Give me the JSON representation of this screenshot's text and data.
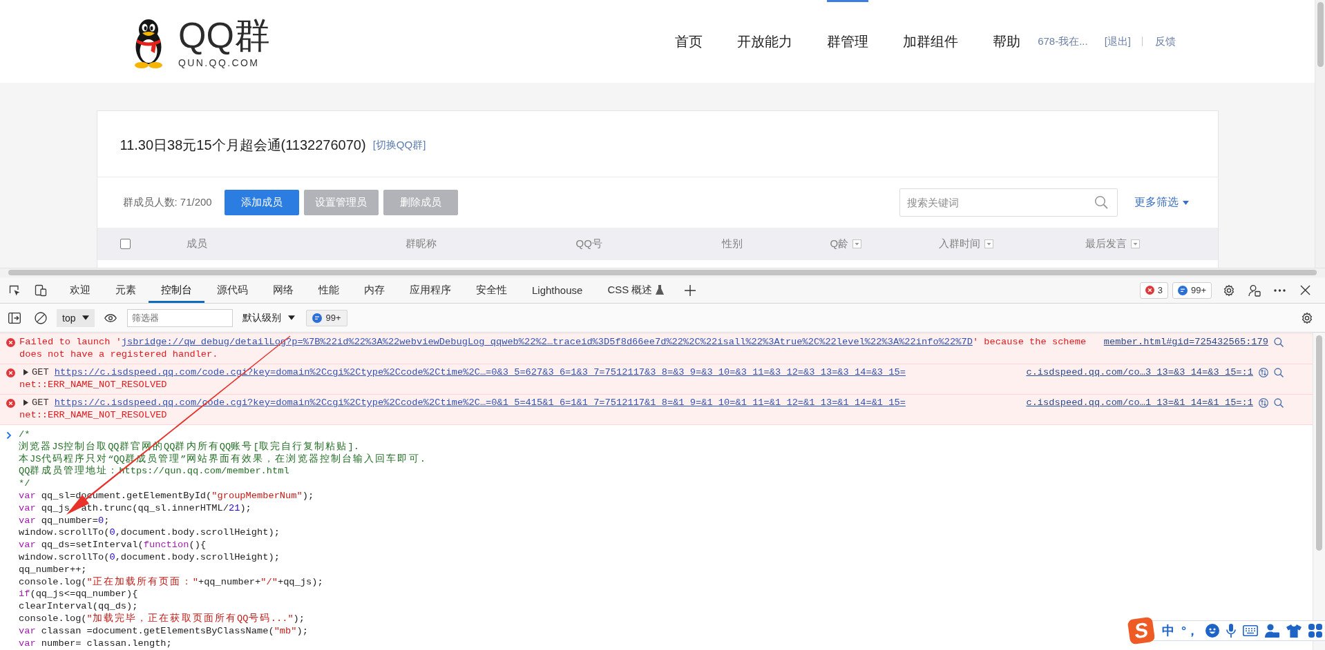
{
  "header": {
    "logo_text": "QQ群",
    "logo_subtitle": "QUN.QQ.COM",
    "nav": [
      {
        "label": "首页",
        "selected": false
      },
      {
        "label": "开放能力",
        "selected": false
      },
      {
        "label": "群管理",
        "selected": true
      },
      {
        "label": "加群组件",
        "selected": false
      },
      {
        "label": "帮助",
        "selected": false
      }
    ],
    "user": "678-我在...",
    "logout": "[退出]",
    "feedback": "反馈"
  },
  "group": {
    "title": "11.30日38元15个月超会通(1132276070)",
    "switch_link": "[切换QQ群]",
    "member_count": "群成员人数: 71/200",
    "buttons": [
      {
        "label": "添加成员",
        "disabled": false
      },
      {
        "label": "设置管理员",
        "disabled": true
      },
      {
        "label": "删除成员",
        "disabled": true
      }
    ],
    "search": {
      "placeholder": "搜索关键词"
    },
    "more_filters": "更多筛选",
    "table": {
      "select_all": {
        "checked": false
      },
      "columns": [
        {
          "label": "成员",
          "sortable": false
        },
        {
          "label": "群昵称",
          "sortable": false
        },
        {
          "label": "QQ号",
          "sortable": false
        },
        {
          "label": "性别",
          "sortable": false
        },
        {
          "label": "Q龄",
          "sortable": true
        },
        {
          "label": "入群时间",
          "sortable": true
        },
        {
          "label": "最后发言",
          "sortable": true
        }
      ]
    }
  },
  "devtools": {
    "tabs": [
      {
        "label": "欢迎",
        "selected": false,
        "experimental": false
      },
      {
        "label": "元素",
        "selected": false,
        "experimental": false
      },
      {
        "label": "控制台",
        "selected": true,
        "experimental": false
      },
      {
        "label": "源代码",
        "selected": false,
        "experimental": false
      },
      {
        "label": "网络",
        "selected": false,
        "experimental": false
      },
      {
        "label": "性能",
        "selected": false,
        "experimental": false
      },
      {
        "label": "内存",
        "selected": false,
        "experimental": false
      },
      {
        "label": "应用程序",
        "selected": false,
        "experimental": false
      },
      {
        "label": "安全性",
        "selected": false,
        "experimental": false
      },
      {
        "label": "Lighthouse",
        "selected": false,
        "experimental": false
      },
      {
        "label": "CSS 概述",
        "selected": false,
        "experimental": true
      }
    ],
    "error_count": "3",
    "message_count": "99+",
    "toolbar": {
      "context": "top",
      "filter": {
        "placeholder": "筛选器"
      },
      "level": "默认级别",
      "issues_count": "99+"
    },
    "messages": [
      {
        "kind": "error",
        "prefix": "Failed to launch '",
        "link": "jsbridge://qw_debug/detailLog?p=%7B%22id%22%3A%22webviewDebugLog_qqweb%22%2…traceid%3D5f8d66ee7d%22%2C%22isall%22%3Atrue%2C%22level%22%3A%22info%22%7D",
        "suffix": "' because the scheme does not have a registered handler.",
        "source": "member.html#gid=725432565:179"
      },
      {
        "kind": "network-error",
        "expanded": false,
        "method": "GET",
        "url": "https://c.isdspeed.qq.com/code.cgi?key=domain%2Ccgi%2Ctype%2Ccode%2Ctime%2C…=0&3_5=627&3_6=1&3_7=7512117&3_8=&3_9=&3_10=&3_11=&3_12=&3_13=&3_14=&3_15=",
        "status": "net::ERR_NAME_NOT_RESOLVED",
        "source": "c.isdspeed.qq.com/co…3_13=&3_14=&3_15=:1"
      },
      {
        "kind": "network-error",
        "expanded": false,
        "method": "GET",
        "url": "https://c.isdspeed.qq.com/code.cgi?key=domain%2Ccgi%2Ctype%2Ccode%2Ctime%2C…=0&1_5=415&1_6=1&1_7=7512117&1_8=&1_9=&1_10=&1_11=&1_12=&1_13=&1_14=&1_15=",
        "status": "net::ERR_NAME_NOT_RESOLVED",
        "source": "c.isdspeed.qq.com/co…1_13=&1_14=&1_15=:1"
      }
    ],
    "input": {
      "lines": [
        [
          {
            "kind": "comment",
            "text": "/*"
          }
        ],
        [
          {
            "kind": "comment",
            "text": "浏览器JS控制台取QQ群官网的QQ群内所有QQ账号[取完自行复制粘贴]."
          }
        ],
        [
          {
            "kind": "comment",
            "text": "本JS代码程序只对“QQ群成员管理”网站界面有效果，在浏览器控制台输入回车即可."
          }
        ],
        [
          {
            "kind": "comment",
            "text": "QQ群成员管理地址：https://qun.qq.com/member.html"
          }
        ],
        [
          {
            "kind": "comment",
            "text": "*/"
          }
        ],
        [
          {
            "kind": "keyword",
            "text": "var"
          },
          {
            "kind": "plain",
            "text": " qq_sl=document.getElementById("
          },
          {
            "kind": "string",
            "text": "\"groupMemberNum\""
          },
          {
            "kind": "plain",
            "text": ");"
          }
        ],
        [
          {
            "kind": "keyword",
            "text": "var"
          },
          {
            "kind": "plain",
            "text": " qq_js"
          },
          {
            "kind": "covered"
          },
          {
            "kind": "plain",
            "text": "ath.trunc(qq_sl.innerHTML/"
          },
          {
            "kind": "number",
            "text": "21"
          },
          {
            "kind": "plain",
            "text": ");"
          }
        ],
        [
          {
            "kind": "keyword",
            "text": "var"
          },
          {
            "kind": "plain",
            "text": " qq_number="
          },
          {
            "kind": "number",
            "text": "0"
          },
          {
            "kind": "plain",
            "text": ";"
          }
        ],
        [
          {
            "kind": "plain",
            "text": "window.scrollTo("
          },
          {
            "kind": "number",
            "text": "0"
          },
          {
            "kind": "plain",
            "text": ",document.body.scrollHeight);"
          }
        ],
        [
          {
            "kind": "keyword",
            "text": "var"
          },
          {
            "kind": "plain",
            "text": " qq_ds=setInterval("
          },
          {
            "kind": "keyword",
            "text": "function"
          },
          {
            "kind": "plain",
            "text": "(){"
          }
        ],
        [
          {
            "kind": "plain",
            "text": "window.scrollTo("
          },
          {
            "kind": "number",
            "text": "0"
          },
          {
            "kind": "plain",
            "text": ",document.body.scrollHeight);"
          }
        ],
        [
          {
            "kind": "plain",
            "text": "qq_number++;"
          }
        ],
        [
          {
            "kind": "plain",
            "text": "console.log("
          },
          {
            "kind": "string",
            "text": "\"正在加载所有页面：\""
          },
          {
            "kind": "plain",
            "text": "+qq_number+"
          },
          {
            "kind": "string",
            "text": "\"/\""
          },
          {
            "kind": "plain",
            "text": "+qq_js);"
          }
        ],
        [
          {
            "kind": "keyword",
            "text": "if"
          },
          {
            "kind": "plain",
            "text": "(qq_js<=qq_number){"
          }
        ],
        [
          {
            "kind": "plain",
            "text": "clearInterval(qq_ds);"
          }
        ],
        [
          {
            "kind": "plain",
            "text": "console.log("
          },
          {
            "kind": "string",
            "text": "\"加载完毕，正在获取页面所有QQ号码...\""
          },
          {
            "kind": "plain",
            "text": ");"
          }
        ],
        [
          {
            "kind": "keyword",
            "text": "var"
          },
          {
            "kind": "plain",
            "text": " classan =document.getElementsByClassName("
          },
          {
            "kind": "string",
            "text": "\"mb\""
          },
          {
            "kind": "plain",
            "text": ");"
          }
        ],
        [
          {
            "kind": "keyword",
            "text": "var"
          },
          {
            "kind": "plain",
            "text": " number= classan.length;"
          }
        ]
      ]
    }
  },
  "ime_bar": {
    "logo": "S",
    "mode": "中",
    "punctuation": "°，"
  }
}
